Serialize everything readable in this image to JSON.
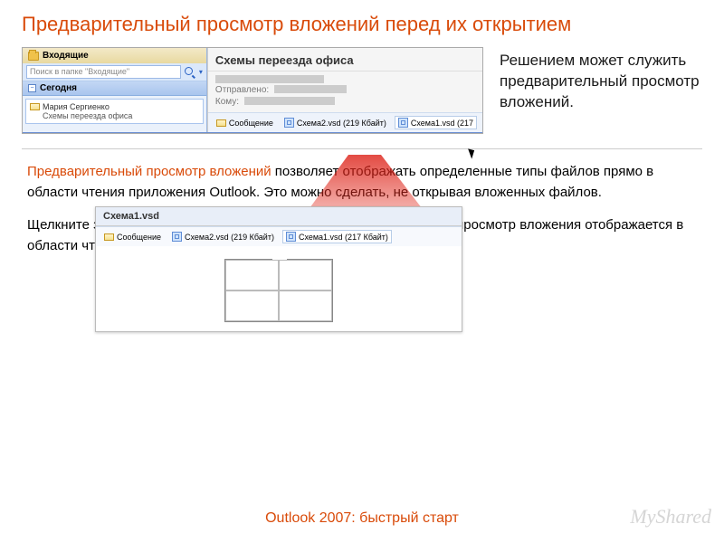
{
  "slide": {
    "title": "Предварительный просмотр вложений перед их открытием",
    "side_text": "Решением может служить предварительный просмотр вложений.",
    "body_p1_a": "Предварительный просмотр вложений",
    "body_p1_b": " позволяет отображать определенные типы файлов прямо в области чтения приложения Outlook. Это можно сделать, не открывая вложенных файлов.",
    "body_p2": "Щелкните значок, чтобы просмотреть вложение. Предварительный просмотр вложения отображается в области чтения.",
    "footer": "Outlook 2007: быстрый старт"
  },
  "outlook": {
    "inbox_label": "Входящие",
    "search_placeholder": "Поиск в папке \"Входящие\"",
    "today_label": "Сегодня",
    "msg_from": "Мария Сергиенко",
    "msg_subject": "Схемы переезда офиса",
    "reading_title": "Схемы переезда офиса",
    "meta_sent_label": "Отправлено:",
    "meta_to_label": "Кому:",
    "attach_msg": "Сообщение",
    "attach1": "Схема2.vsd (219 Кбайт)",
    "attach2": "Схема1.vsd (217",
    "preview_title": "Схема1.vsd",
    "preview_attach1": "Сообщение",
    "preview_attach2": "Схема2.vsd (219 Кбайт)",
    "preview_attach3": "Схема1.vsd (217 Кбайт)"
  },
  "watermark": {
    "brand": "MyShared",
    "tag": ""
  }
}
